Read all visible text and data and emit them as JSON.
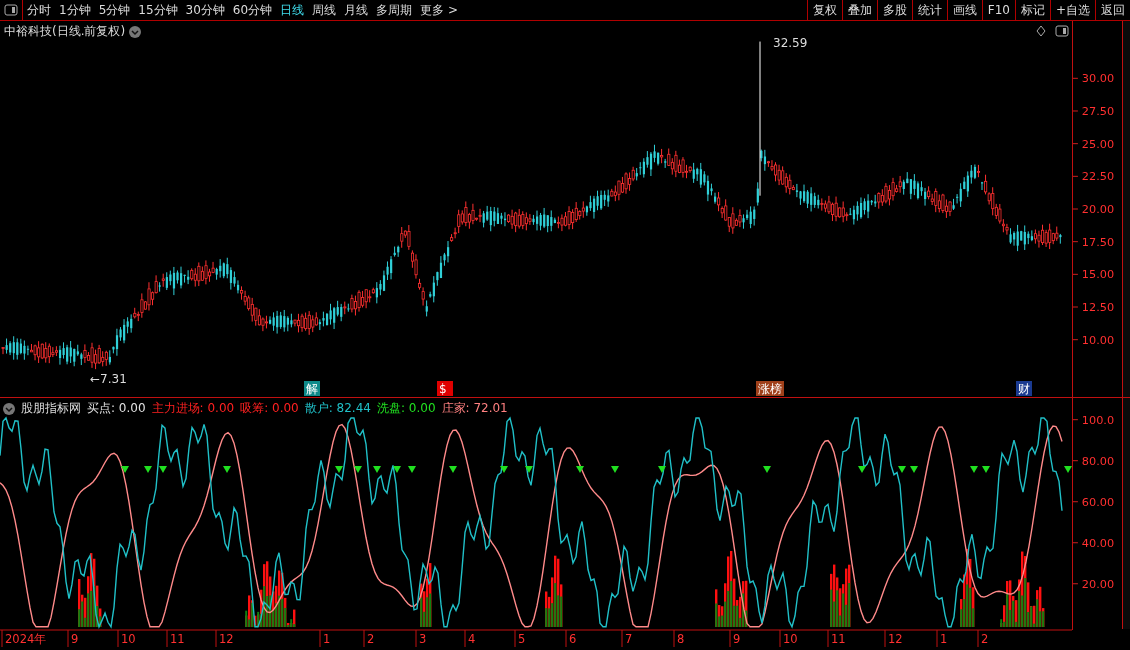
{
  "toolbar": {
    "periods": [
      {
        "label": "分时",
        "selected": false
      },
      {
        "label": "1分钟",
        "selected": false
      },
      {
        "label": "5分钟",
        "selected": false
      },
      {
        "label": "15分钟",
        "selected": false
      },
      {
        "label": "30分钟",
        "selected": false
      },
      {
        "label": "60分钟",
        "selected": false
      },
      {
        "label": "日线",
        "selected": true
      },
      {
        "label": "周线",
        "selected": false
      },
      {
        "label": "月线",
        "selected": false
      },
      {
        "label": "多周期",
        "selected": false
      },
      {
        "label": "更多 >",
        "selected": false
      }
    ],
    "actions": [
      "复权",
      "叠加",
      "多股",
      "统计",
      "画线",
      "F10",
      "标记",
      "+自选",
      "返回"
    ]
  },
  "price_chart": {
    "title": "中裕科技(日线.前复权)",
    "high_label": "32.59",
    "low_label": "←7.31",
    "axis_ticks": [
      "30.00",
      "27.50",
      "25.00",
      "22.50",
      "20.00",
      "17.50",
      "15.00",
      "12.50",
      "10.00"
    ],
    "events": [
      {
        "label": "解",
        "color": "#0f8a8a"
      },
      {
        "label": "$",
        "color": "#e00000"
      },
      {
        "label": "涨榜",
        "color": "#a0401a"
      },
      {
        "label": "财",
        "color": "#1a3a90"
      }
    ]
  },
  "indicator": {
    "title": "股朋指标网",
    "readings": [
      {
        "label": "买点:",
        "value": "0.00",
        "color": "#e0e0e0"
      },
      {
        "label": "主力进场:",
        "value": "0.00",
        "color": "#ff2020"
      },
      {
        "label": "吸筹:",
        "value": "0.00",
        "color": "#ff2020"
      },
      {
        "label": "散户:",
        "value": "82.44",
        "color": "#20c0c8"
      },
      {
        "label": "洗盘:",
        "value": "0.00",
        "color": "#20e020"
      },
      {
        "label": "庄家:",
        "value": "72.01",
        "color": "#ff8080"
      }
    ],
    "axis_ticks": [
      "100.0",
      "80.00",
      "60.00",
      "40.00",
      "20.00"
    ]
  },
  "date_axis": [
    "2024年",
    "9",
    "10",
    "11",
    "12",
    "1",
    "2",
    "3",
    "4",
    "5",
    "6",
    "7",
    "8",
    "9",
    "10",
    "11",
    "12",
    "1",
    "2"
  ]
}
